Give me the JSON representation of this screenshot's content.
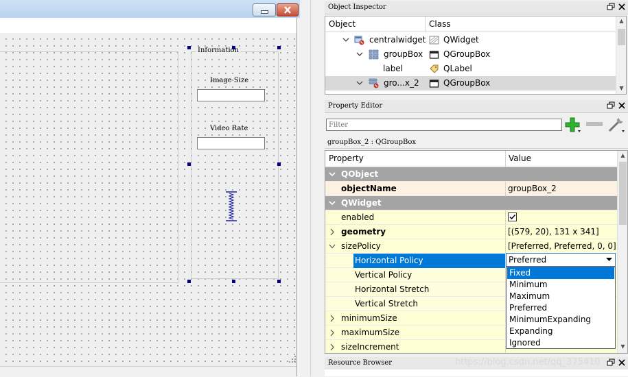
{
  "form_window": {
    "groupbox_title": "Information",
    "image_size_label": "Image Size",
    "video_rate_label": "Video Rate",
    "image_size_value": "",
    "video_rate_value": ""
  },
  "object_inspector": {
    "title": "Object Inspector",
    "columns": [
      "Object",
      "Class"
    ],
    "rows": [
      {
        "object": "centralwidget",
        "class": "QWidget",
        "icon": "widget-icon",
        "class_icon": "qwidget-icon",
        "expanded": true,
        "depth": 0,
        "selected": false
      },
      {
        "object": "groupBox",
        "class": "QGroupBox",
        "icon": "grid-layout-icon",
        "class_icon": "qgroupbox-icon",
        "expanded": true,
        "depth": 1,
        "selected": false
      },
      {
        "object": "label",
        "class": "QLabel",
        "icon": "",
        "class_icon": "qlabel-icon",
        "expanded": null,
        "depth": 2,
        "selected": false
      },
      {
        "object": "gro...x_2",
        "class": "QGroupBox",
        "icon": "vbox-layout-icon",
        "class_icon": "qgroupbox-icon",
        "expanded": true,
        "depth": 1,
        "selected": true
      }
    ]
  },
  "property_editor": {
    "title": "Property Editor",
    "filter_placeholder": "Filter",
    "context": "groupBox_2 : QGroupBox",
    "columns": [
      "Property",
      "Value"
    ],
    "rows": [
      {
        "name": "QObject",
        "value": "",
        "kind": "group"
      },
      {
        "name": "objectName",
        "value": "groupBox_2",
        "kind": "cream",
        "bold": true
      },
      {
        "name": "QWidget",
        "value": "",
        "kind": "group"
      },
      {
        "name": "enabled",
        "value": "",
        "kind": "yellow",
        "checked": true
      },
      {
        "name": "geometry",
        "value": "[(579, 20), 131 x 341]",
        "kind": "yellow",
        "bold": true,
        "expandable": true
      },
      {
        "name": "sizePolicy",
        "value": "[Preferred, Preferred, 0, 0]",
        "kind": "yellow",
        "expanded": true
      },
      {
        "name": "Horizontal Policy",
        "value": "Preferred",
        "kind": "sub",
        "selected": true
      },
      {
        "name": "Vertical Policy",
        "value": "",
        "kind": "sub"
      },
      {
        "name": "Horizontal Stretch",
        "value": "",
        "kind": "sub"
      },
      {
        "name": "Vertical Stretch",
        "value": "",
        "kind": "sub"
      },
      {
        "name": "minimumSize",
        "value": "",
        "kind": "yellow",
        "expandable": true
      },
      {
        "name": "maximumSize",
        "value": "",
        "kind": "yellow",
        "expandable": true
      },
      {
        "name": "sizeIncrement",
        "value": "",
        "kind": "yellow",
        "expandable": true
      }
    ],
    "combo_value": "Preferred",
    "combo_options": [
      "Fixed",
      "Minimum",
      "Maximum",
      "Preferred",
      "MinimumExpanding",
      "Expanding",
      "Ignored"
    ],
    "combo_highlighted": "Fixed"
  },
  "resource_browser": {
    "title": "Resource Browser"
  },
  "watermark": "https://blog.csdn.net/qq_375410",
  "colors": {
    "selection": "#0078d7",
    "group_row": "#a4a4a4",
    "property_row": "#fefed4",
    "objectname_row": "#fdf2e2"
  }
}
